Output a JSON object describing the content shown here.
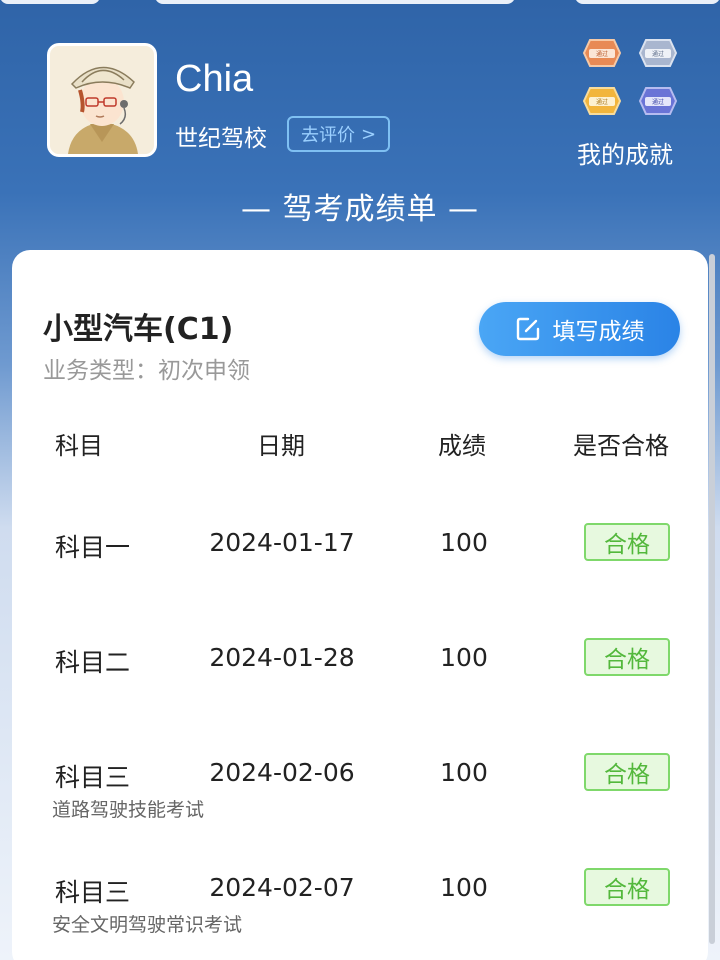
{
  "profile": {
    "name": "Chia",
    "school": "世纪驾校",
    "rate_label": "去评价",
    "rate_chevron": ">",
    "achievements_label": "我的成就",
    "badges": [
      {
        "icon": "bronze-pass-badge-icon",
        "text": "通过",
        "color": "#e88a55"
      },
      {
        "icon": "silver-pass-badge-icon",
        "text": "通过",
        "color": "#a9b6cf"
      },
      {
        "icon": "gold-pass-badge-icon",
        "text": "通过",
        "color": "#f2b53c"
      },
      {
        "icon": "purple-pass-badge-icon",
        "text": "通过",
        "color": "#6a74d6"
      }
    ]
  },
  "section_title": "— 驾考成绩单 —",
  "license": {
    "type": "小型汽车(C1)",
    "business_type": "业务类型：初次申领",
    "fill_button": "填写成绩"
  },
  "table": {
    "headers": [
      "科目",
      "日期",
      "成绩",
      "是否合格"
    ],
    "rows": [
      {
        "subject": "科目一",
        "sub_label": "",
        "date": "2024-01-17",
        "score": "100",
        "result": "合格"
      },
      {
        "subject": "科目二",
        "sub_label": "",
        "date": "2024-01-28",
        "score": "100",
        "result": "合格"
      },
      {
        "subject": "科目三",
        "sub_label": "道路驾驶技能考试",
        "date": "2024-02-06",
        "score": "100",
        "result": "合格"
      },
      {
        "subject": "科目三",
        "sub_label": "安全文明驾驶常识考试",
        "date": "2024-02-07",
        "score": "100",
        "result": "合格"
      }
    ]
  },
  "colors": {
    "header_blue": "#2f64a8",
    "accent_blue": "#2a83e6",
    "pass_green": "#53b83c"
  }
}
